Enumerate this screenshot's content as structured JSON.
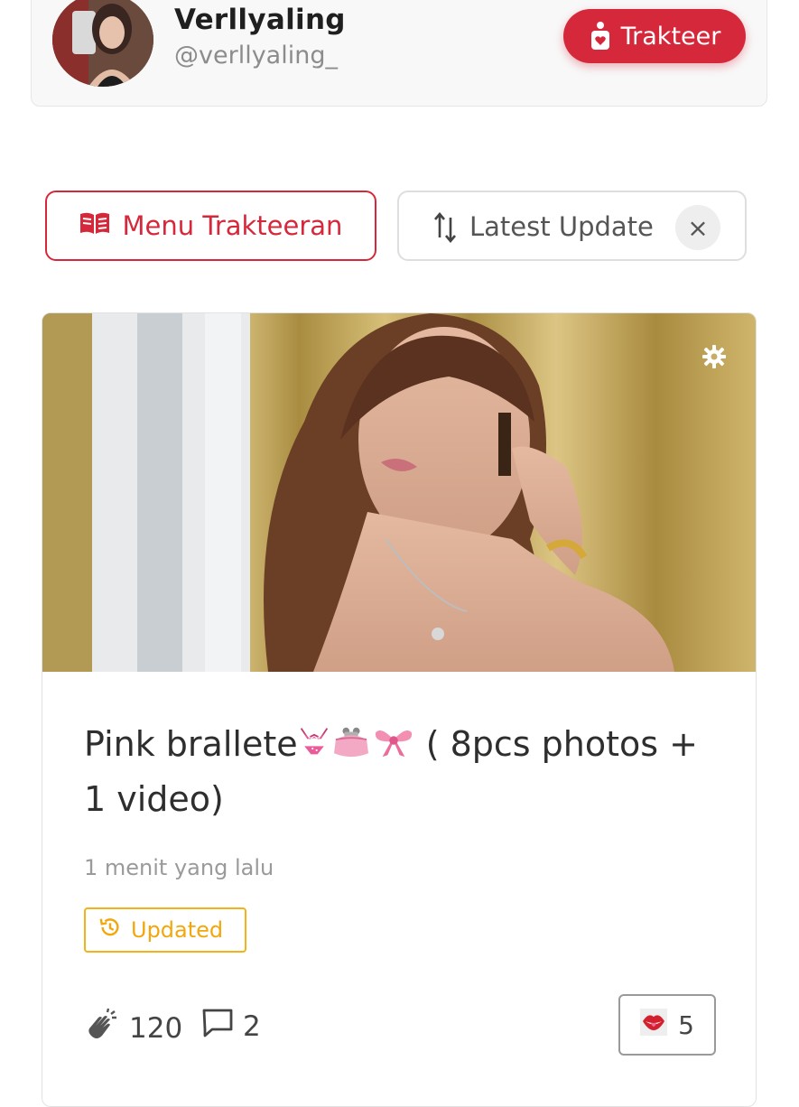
{
  "profile": {
    "display_name": "Verllyaling",
    "username": "@verllyaling_",
    "support_button_label": "Trakteer"
  },
  "toolbar": {
    "menu_label": "Menu Trakteeran",
    "sort_label": "Latest Update",
    "clear_icon": "×"
  },
  "post": {
    "title_text": "Pink brallete",
    "title_emojis": [
      "bikini",
      "purse",
      "ribbon"
    ],
    "title_suffix": "( 8pcs photos + 1 video)",
    "timestamp": "1 menit yang lalu",
    "status_badge": "Updated",
    "applause_count": "120",
    "comment_count": "2",
    "reaction_count": "5"
  },
  "colors": {
    "brand_red": "#d6283b",
    "badge_yellow": "#f2b21a",
    "muted_gray": "#9a9a9a"
  },
  "icons": [
    "avatar-photo",
    "cup-heart-icon",
    "book-icon",
    "sort-arrows-icon",
    "close-icon",
    "gear-icon",
    "history-icon",
    "clapping-hands-icon",
    "comment-icon",
    "lips-icon"
  ]
}
